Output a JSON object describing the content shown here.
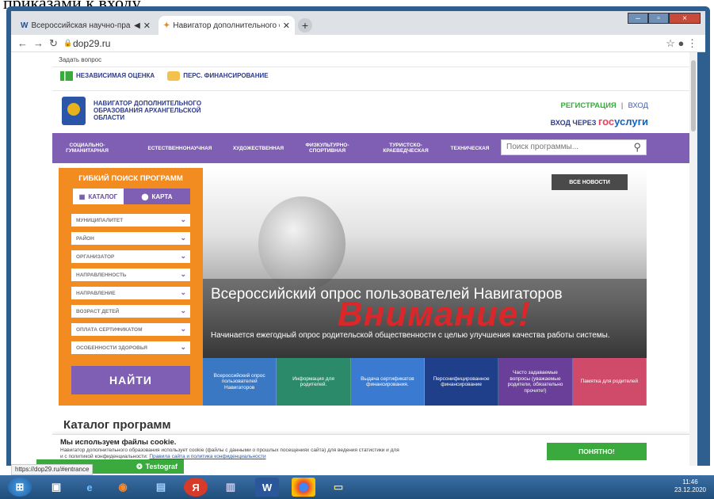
{
  "document_strip": "приказами к входу.",
  "browser": {
    "tabs": [
      {
        "title": "Всероссийская научно-пра",
        "icon": "W"
      },
      {
        "title": "Навигатор дополнительного о",
        "icon": "✦"
      }
    ],
    "new_tab": "+",
    "url": "dop29.ru",
    "window_controls": [
      "–",
      "▫",
      "×"
    ]
  },
  "page": {
    "ask": "Задать вопрос",
    "top_links": [
      "НЕЗАВИСИМАЯ ОЦЕНКА",
      "ПЕРС. ФИНАНСИРОВАНИЕ"
    ],
    "brand": "НАВИГАТОР ДОПОЛНИТЕЛЬНОГО ОБРАЗОВАНИЯ АРХАНГЕЛЬСКОЙ ОБЛАСТИ",
    "register": "РЕГИСТРАЦИЯ",
    "login": "ВХОД",
    "gos_prefix": "ВХОД ЧЕРЕЗ",
    "gos_a": "гос",
    "gos_b": "услуги",
    "menu": [
      "СОЦИАЛЬНО-ГУМАНИТАРНАЯ",
      "ЕСТЕСТВЕННОНАУЧНАЯ",
      "ХУДОЖЕСТВЕННАЯ",
      "ФИЗКУЛЬТУРНО-СПОРТИВНАЯ",
      "ТУРИСТСКО-КРАЕВЕДЧЕСКАЯ",
      "ТЕХНИЧЕСКАЯ"
    ],
    "search_placeholder": "Поиск программы..."
  },
  "filter": {
    "title": "ГИБКИЙ ПОИСК ПРОГРАММ",
    "catalog": "КАТАЛОГ",
    "map": "КАРТА",
    "selects": [
      "МУНИЦИПАЛИТЕТ",
      "РАЙОН",
      "ОРГАНИЗАТОР",
      "НАПРАВЛЕННОСТЬ",
      "НАПРАВЛЕНИЕ",
      "ВОЗРАСТ ДЕТЕЙ",
      "ОПЛАТА СЕРТИФИКАТОМ",
      "ОСОБЕННОСТИ ЗДОРОВЬЯ"
    ],
    "find": "НАЙТИ"
  },
  "banner": {
    "all_news": "ВСЕ НОВОСТИ",
    "headline": "Всероссийский опрос пользователей Навигаторов",
    "subtitle": "Начинается ежегодный опрос родительской общественности с целью улучшения качества работы системы.",
    "sign": "Внимание!",
    "thumbs": [
      "Всероссийский опрос пользователей Навигаторов",
      "Информация для родителей.",
      "Выдача сертификатов финансирования.",
      "Персонифицированное финансирование",
      "Часто задаваемые вопросы (уважаемые родители, обязательно прочите!)",
      "Памятка для родителей"
    ]
  },
  "catalog_title": "Каталог программ",
  "cookie": {
    "title": "Мы используем файлы cookie.",
    "text": "Навигатор дополнительного образования использует cookie (файлы с данными о прошлых посещениях сайта) для ведения статистики и для",
    "text2": "и с политикой конфиденциальности: ",
    "link": "Правила сайта и политика конфиденциальности",
    "button": "ПОНЯТНО!"
  },
  "status_url": "https://dop29.ru/#entrance",
  "testograf": "Testograf",
  "clock": {
    "time": "11:46",
    "date": "23.12.2020"
  }
}
